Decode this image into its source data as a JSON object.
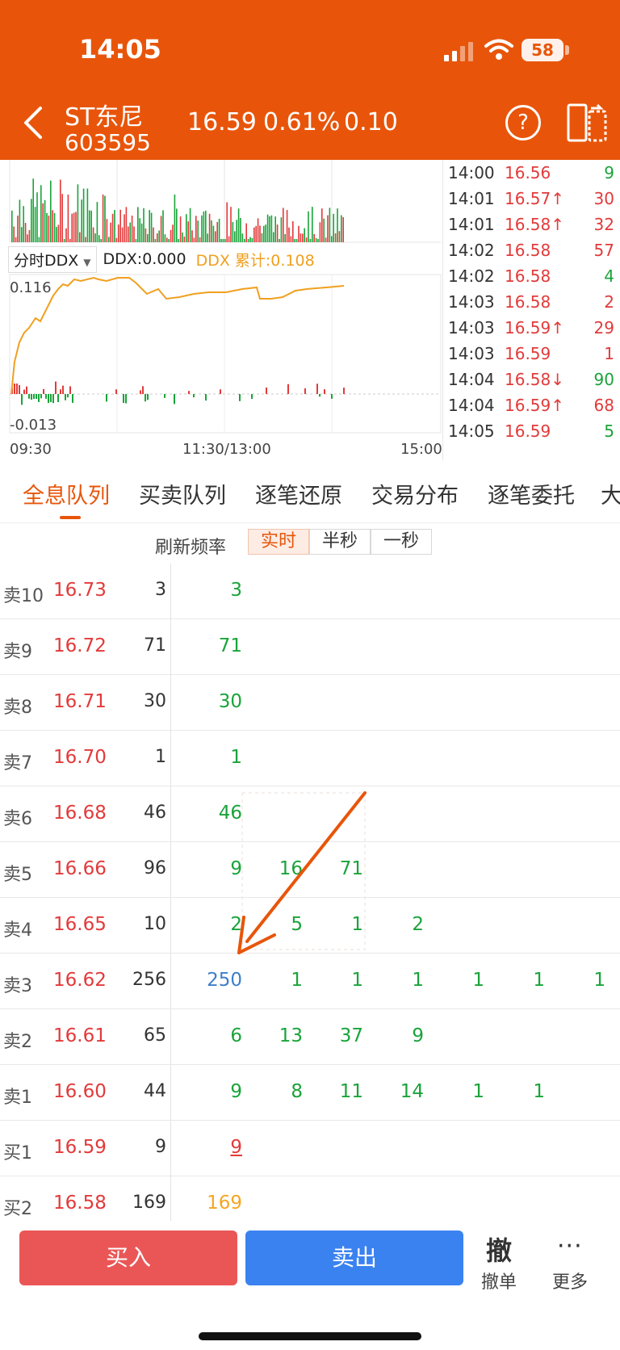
{
  "status_bar": {
    "time": "14:05",
    "battery": "58"
  },
  "stock": {
    "name": "ST东尼",
    "code": "603595",
    "price": "16.59",
    "pct": "0.61%",
    "change": "0.10"
  },
  "icons": {
    "back": "back-arrow-icon",
    "help": "help-icon",
    "switch": "switch-layout-icon"
  },
  "chart": {
    "indicator": "分时DDX",
    "ddx": "DDX:0.000",
    "ddx_sum": "DDX 累计:0.108",
    "y_top": "0.116",
    "y_bottom": "-0.013",
    "x_start": "09:30",
    "x_mid": "11:30/13:00",
    "x_end": "15:00",
    "colors": {
      "line": "#f0a020",
      "up": "#e23a3a",
      "down": "#1aa33a"
    }
  },
  "ticks": [
    {
      "time": "14:00",
      "price": "16.56",
      "dir": "",
      "vol": "9",
      "pc": "red",
      "vc": "green"
    },
    {
      "time": "14:01",
      "price": "16.57",
      "dir": "↑",
      "vol": "30",
      "pc": "red",
      "vc": "red"
    },
    {
      "time": "14:01",
      "price": "16.58",
      "dir": "↑",
      "vol": "32",
      "pc": "red",
      "vc": "red"
    },
    {
      "time": "14:02",
      "price": "16.58",
      "dir": "",
      "vol": "57",
      "pc": "red",
      "vc": "red"
    },
    {
      "time": "14:02",
      "price": "16.58",
      "dir": "",
      "vol": "4",
      "pc": "red",
      "vc": "green"
    },
    {
      "time": "14:03",
      "price": "16.58",
      "dir": "",
      "vol": "2",
      "pc": "red",
      "vc": "red"
    },
    {
      "time": "14:03",
      "price": "16.59",
      "dir": "↑",
      "vol": "29",
      "pc": "red",
      "vc": "red"
    },
    {
      "time": "14:03",
      "price": "16.59",
      "dir": "",
      "vol": "1",
      "pc": "red",
      "vc": "red"
    },
    {
      "time": "14:04",
      "price": "16.58",
      "dir": "↓",
      "vol": "90",
      "pc": "red",
      "vc": "green"
    },
    {
      "time": "14:04",
      "price": "16.59",
      "dir": "↑",
      "vol": "68",
      "pc": "red",
      "vc": "red"
    },
    {
      "time": "14:05",
      "price": "16.59",
      "dir": "",
      "vol": "5",
      "pc": "red",
      "vc": "green"
    }
  ],
  "tabs": [
    "全息队列",
    "买卖队列",
    "逐笔还原",
    "交易分布",
    "逐笔委托",
    "大"
  ],
  "refresh": {
    "label": "刷新频率",
    "options": [
      "实时",
      "半秒",
      "一秒"
    ]
  },
  "book": [
    {
      "label": "卖10",
      "price": "16.73",
      "total": "3",
      "orders": [
        "3"
      ],
      "colors": [
        "green"
      ]
    },
    {
      "label": "卖9",
      "price": "16.72",
      "total": "71",
      "orders": [
        "71"
      ],
      "colors": [
        "green"
      ]
    },
    {
      "label": "卖8",
      "price": "16.71",
      "total": "30",
      "orders": [
        "30"
      ],
      "colors": [
        "green"
      ]
    },
    {
      "label": "卖7",
      "price": "16.70",
      "total": "1",
      "orders": [
        "1"
      ],
      "colors": [
        "green"
      ]
    },
    {
      "label": "卖6",
      "price": "16.68",
      "total": "46",
      "orders": [
        "46"
      ],
      "colors": [
        "green"
      ]
    },
    {
      "label": "卖5",
      "price": "16.66",
      "total": "96",
      "orders": [
        "9",
        "16",
        "71"
      ],
      "colors": [
        "green",
        "green",
        "green"
      ]
    },
    {
      "label": "卖4",
      "price": "16.65",
      "total": "10",
      "orders": [
        "2",
        "5",
        "1",
        "2"
      ],
      "colors": [
        "green",
        "green",
        "green",
        "green"
      ]
    },
    {
      "label": "卖3",
      "price": "16.62",
      "total": "256",
      "orders": [
        "250",
        "1",
        "1",
        "1",
        "1",
        "1",
        "1"
      ],
      "colors": [
        "blue",
        "green",
        "green",
        "green",
        "green",
        "green",
        "green"
      ]
    },
    {
      "label": "卖2",
      "price": "16.61",
      "total": "65",
      "orders": [
        "6",
        "13",
        "37",
        "9"
      ],
      "colors": [
        "green",
        "green",
        "green",
        "green"
      ]
    },
    {
      "label": "卖1",
      "price": "16.60",
      "total": "44",
      "orders": [
        "9",
        "8",
        "11",
        "14",
        "1",
        "1"
      ],
      "colors": [
        "green",
        "green",
        "green",
        "green",
        "green",
        "green"
      ]
    },
    {
      "label": "买1",
      "price": "16.59",
      "total": "9",
      "orders": [
        "9"
      ],
      "colors": [
        "red-ul"
      ]
    },
    {
      "label": "买2",
      "price": "16.58",
      "total": "169",
      "orders": [
        "169"
      ],
      "colors": [
        "orange"
      ]
    }
  ],
  "actions": {
    "buy": "买入",
    "sell": "卖出",
    "cancel_icon": "撤",
    "cancel": "撤单",
    "more_icon": "···",
    "more": "更多"
  }
}
